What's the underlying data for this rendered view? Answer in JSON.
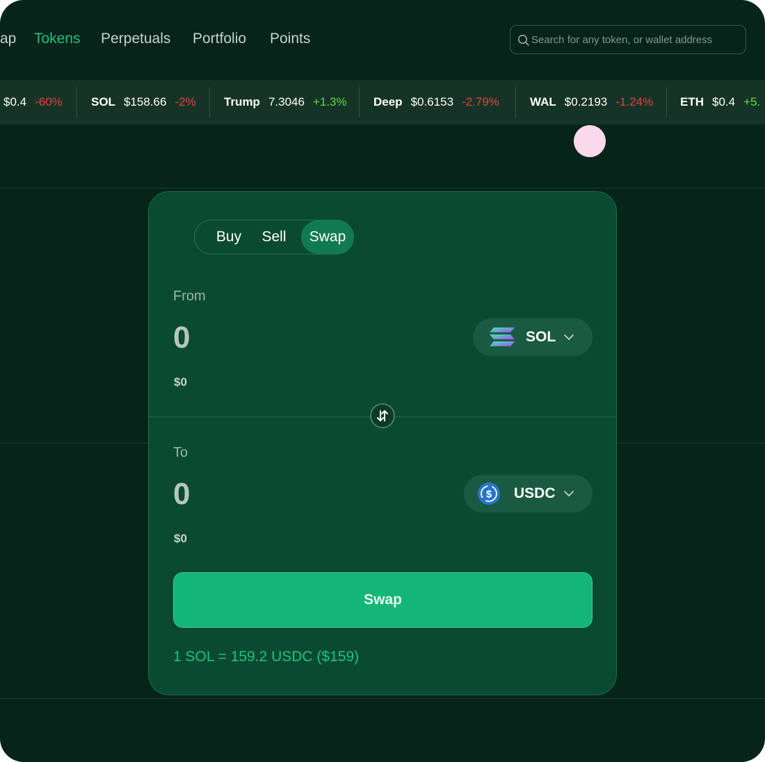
{
  "nav": {
    "items": [
      {
        "label": "ap",
        "active": false
      },
      {
        "label": "Tokens",
        "active": true
      },
      {
        "label": "Perpetuals",
        "active": false
      },
      {
        "label": "Portfolio",
        "active": false
      },
      {
        "label": "Points",
        "active": false
      }
    ],
    "search_placeholder": "Search for any token, or wallet address",
    "search_icon": "search-icon"
  },
  "ticker": [
    {
      "symbol": "",
      "price": "$0.4",
      "change": "-60%",
      "direction": "down"
    },
    {
      "symbol": "SOL",
      "price": "$158.66",
      "change": "-2%",
      "direction": "down"
    },
    {
      "symbol": "Trump",
      "price": "7.3046",
      "change": "+1.3%",
      "direction": "up"
    },
    {
      "symbol": "Deep",
      "price": "$0.6153",
      "change": "-2.79%",
      "direction": "down"
    },
    {
      "symbol": "WAL",
      "price": "$0.2193",
      "change": "-1.24%",
      "direction": "down"
    },
    {
      "symbol": "ETH",
      "price": "$0.4",
      "change": "+5.",
      "direction": "up"
    }
  ],
  "trade": {
    "tabs": [
      {
        "label": "Buy",
        "active": false
      },
      {
        "label": "Sell",
        "active": false
      },
      {
        "label": "Swap",
        "active": true
      }
    ],
    "from": {
      "label": "From",
      "amount": "0",
      "usd": "$0",
      "token": "SOL",
      "token_icon": "solana-logo-icon"
    },
    "to": {
      "label": "To",
      "amount": "0",
      "usd": "$0",
      "token": "USDC",
      "token_icon": "usdc-logo-icon"
    },
    "flip_icon": "swap-arrows-icon",
    "swap_button": "Swap",
    "rate": "1 SOL = 159.2 USDC ($159)"
  },
  "colors": {
    "background": "#06241a",
    "card": "#0a4a32",
    "accent": "#13b676",
    "active_text": "#22c17f",
    "negative": "#e2433c",
    "positive": "#5fde3a"
  }
}
